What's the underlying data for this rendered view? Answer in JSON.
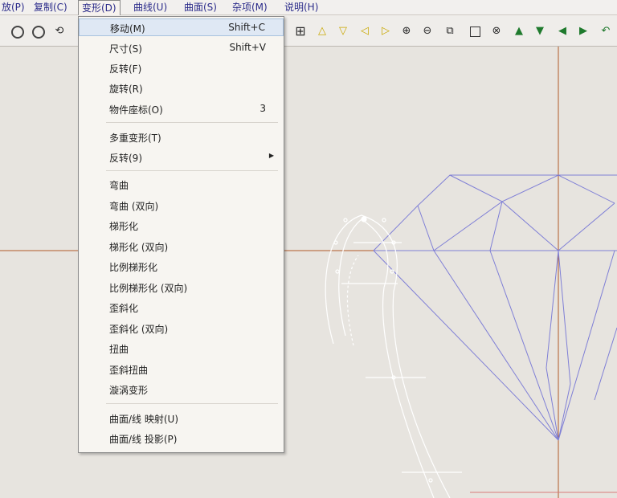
{
  "menubar": {
    "items": [
      {
        "label": "放(P)"
      },
      {
        "label": "复制(C)"
      },
      {
        "label": "变形(D)"
      },
      {
        "label": "曲线(U)"
      },
      {
        "label": "曲面(S)"
      },
      {
        "label": "杂项(M)"
      },
      {
        "label": "说明(H)"
      }
    ]
  },
  "dropdown": {
    "items": [
      {
        "label": "移动(M)",
        "shortcut": "Shift+C"
      },
      {
        "label": "尺寸(S)",
        "shortcut": "Shift+V"
      },
      {
        "label": "反转(F)"
      },
      {
        "label": "旋转(R)"
      },
      {
        "label": "物件座标(O)",
        "shortcut": "3"
      },
      {
        "label": "多重变形(T)"
      },
      {
        "label": "反转(9)",
        "submenu": true
      },
      {
        "label": "弯曲"
      },
      {
        "label": "弯曲 (双向)"
      },
      {
        "label": "梯形化"
      },
      {
        "label": "梯形化 (双向)"
      },
      {
        "label": "比例梯形化"
      },
      {
        "label": "比例梯形化 (双向)"
      },
      {
        "label": "歪斜化"
      },
      {
        "label": "歪斜化 (双向)"
      },
      {
        "label": "扭曲"
      },
      {
        "label": "歪斜扭曲"
      },
      {
        "label": "漩涡变形"
      },
      {
        "label": "曲面/线 映射(U)"
      },
      {
        "label": "曲面/线 投影(P)"
      }
    ]
  },
  "colors": {
    "menu_text": "#2b2b8a",
    "axis": "#b05a2a",
    "wire_gem": "#7f7fd6",
    "wire_ring": "#ffffff"
  }
}
